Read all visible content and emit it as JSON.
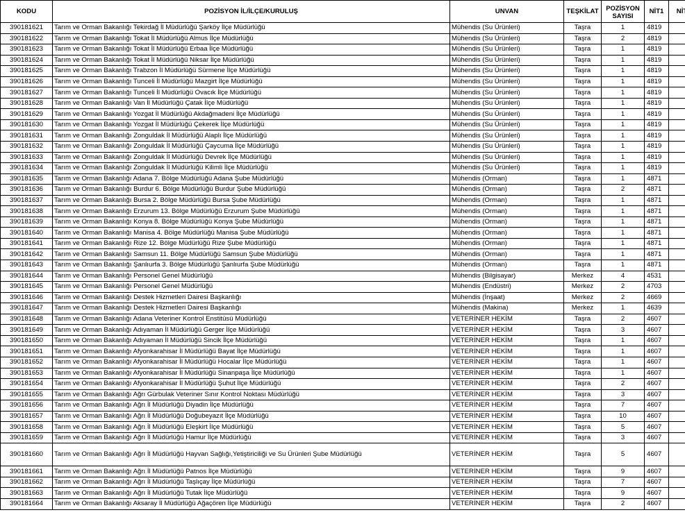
{
  "headers": [
    "KODU",
    "POZİSYON İL/İLÇE/KURULUŞ",
    "UNVAN",
    "TEŞKİLAT",
    "POZİSYON SAYISI",
    "NİT1",
    "NİT"
  ],
  "rows": [
    [
      "390181621",
      "Tarım ve Orman Bakanlığı Tekirdağ İl Müdürlüğü Şarköy İlçe Müdürlüğü",
      "Mühendis (Su Ürünleri)",
      "Taşra",
      "1",
      "4819",
      ""
    ],
    [
      "390181622",
      "Tarım ve Orman Bakanlığı Tokat İl Müdürlüğü Almus İlçe Müdürlüğü",
      "Mühendis (Su Ürünleri)",
      "Taşra",
      "2",
      "4819",
      ""
    ],
    [
      "390181623",
      "Tarım ve Orman Bakanlığı Tokat İl Müdürlüğü Erbaa İlçe Müdürlüğü",
      "Mühendis (Su Ürünleri)",
      "Taşra",
      "1",
      "4819",
      ""
    ],
    [
      "390181624",
      "Tarım ve Orman Bakanlığı Tokat İl Müdürlüğü Niksar İlçe Müdürlüğü",
      "Mühendis (Su Ürünleri)",
      "Taşra",
      "1",
      "4819",
      ""
    ],
    [
      "390181625",
      "Tarım ve Orman Bakanlığı Trabzon İl Müdürlüğü Sürmene İlçe Müdürlüğü",
      "Mühendis (Su Ürünleri)",
      "Taşra",
      "1",
      "4819",
      ""
    ],
    [
      "390181626",
      "Tarım ve Orman Bakanlığı Tunceli İl Müdürlüğü Mazgirt İlçe Müdürlüğü",
      "Mühendis (Su Ürünleri)",
      "Taşra",
      "1",
      "4819",
      ""
    ],
    [
      "390181627",
      "Tarım ve Orman Bakanlığı Tunceli İl Müdürlüğü Ovacık İlçe Müdürlüğü",
      "Mühendis (Su Ürünleri)",
      "Taşra",
      "1",
      "4819",
      ""
    ],
    [
      "390181628",
      "Tarım ve Orman Bakanlığı Van İl Müdürlüğü Çatak İlçe Müdürlüğü",
      "Mühendis (Su Ürünleri)",
      "Taşra",
      "1",
      "4819",
      ""
    ],
    [
      "390181629",
      "Tarım ve Orman Bakanlığı Yozgat İl Müdürlüğü Akdağmadeni İlçe Müdürlüğü",
      "Mühendis (Su Ürünleri)",
      "Taşra",
      "1",
      "4819",
      ""
    ],
    [
      "390181630",
      "Tarım ve Orman Bakanlığı Yozgat İl Müdürlüğü Çekerek İlçe Müdürlüğü",
      "Mühendis (Su Ürünleri)",
      "Taşra",
      "1",
      "4819",
      ""
    ],
    [
      "390181631",
      "Tarım ve Orman Bakanlığı Zonguldak İl Müdürlüğü Alaplı İlçe Müdürlüğü",
      "Mühendis (Su Ürünleri)",
      "Taşra",
      "1",
      "4819",
      ""
    ],
    [
      "390181632",
      "Tarım ve Orman Bakanlığı Zonguldak İl Müdürlüğü Çaycuma İlçe Müdürlüğü",
      "Mühendis (Su Ürünleri)",
      "Taşra",
      "1",
      "4819",
      ""
    ],
    [
      "390181633",
      "Tarım ve Orman Bakanlığı Zonguldak İl Müdürlüğü Devrek İlçe Müdürlüğü",
      "Mühendis (Su Ürünleri)",
      "Taşra",
      "1",
      "4819",
      ""
    ],
    [
      "390181634",
      "Tarım ve Orman Bakanlığı Zonguldak İl Müdürlüğü Kilimli İlçe Müdürlüğü",
      "Mühendis (Su Ürünleri)",
      "Taşra",
      "1",
      "4819",
      ""
    ],
    [
      "390181635",
      "Tarım ve Orman Bakanlığı Adana 7. Bölge Müdürlüğü Adana Şube Müdürlüğü",
      "Mühendis (Orman)",
      "Taşra",
      "1",
      "4871",
      ""
    ],
    [
      "390181636",
      "Tarım ve Orman Bakanlığı Burdur 6. Bölge Müdürlüğü Burdur Şube Müdürlüğü",
      "Mühendis (Orman)",
      "Taşra",
      "2",
      "4871",
      ""
    ],
    [
      "390181637",
      "Tarım ve Orman Bakanlığı Bursa 2. Bölge Müdürlüğü Bursa Şube Müdürlüğü",
      "Mühendis (Orman)",
      "Taşra",
      "1",
      "4871",
      ""
    ],
    [
      "390181638",
      "Tarım ve Orman Bakanlığı Erzurum 13. Bölge Müdürlüğü Erzurum Şube Müdürlüğü",
      "Mühendis (Orman)",
      "Taşra",
      "1",
      "4871",
      ""
    ],
    [
      "390181639",
      "Tarım ve Orman Bakanlığı Konya 8. Bölge Müdürlüğü Konya Şube Müdürlüğü",
      "Mühendis (Orman)",
      "Taşra",
      "1",
      "4871",
      ""
    ],
    [
      "390181640",
      "Tarım ve Orman Bakanlığı Manisa 4. Bölge Müdürlüğü Manisa Şube Müdürlüğü",
      "Mühendis (Orman)",
      "Taşra",
      "1",
      "4871",
      ""
    ],
    [
      "390181641",
      "Tarım ve Orman Bakanlığı Rize 12. Bölge Müdürlüğü Rize Şube Müdürlüğü",
      "Mühendis (Orman)",
      "Taşra",
      "1",
      "4871",
      ""
    ],
    [
      "390181642",
      "Tarım ve Orman Bakanlığı Samsun 11. Bölge Müdürlüğü Samsun Şube Müdürlüğü",
      "Mühendis (Orman)",
      "Taşra",
      "1",
      "4871",
      ""
    ],
    [
      "390181643",
      "Tarım ve Orman Bakanlığı Şanlıurfa 3. Bölge Müdürlüğü Şanlıurfa Şube Müdürlüğü",
      "Mühendis (Orman)",
      "Taşra",
      "1",
      "4871",
      ""
    ],
    [
      "390181644",
      "Tarım ve Orman Bakanlığı Personel Genel Müdürlüğü",
      "Mühendis (Bilgisayar)",
      "Merkez",
      "4",
      "4531",
      ""
    ],
    [
      "390181645",
      "Tarım ve Orman Bakanlığı Personel Genel Müdürlüğü",
      "Mühendis (Endüstri)",
      "Merkez",
      "2",
      "4703",
      ""
    ],
    [
      "390181646",
      "Tarım ve Orman Bakanlığı Destek Hizmetleri Dairesi Başkanlığı",
      "Mühendis (İnşaat)",
      "Merkez",
      "2",
      "4669",
      ""
    ],
    [
      "390181647",
      "Tarım ve Orman Bakanlığı Destek Hizmetleri Dairesi Başkanlığı",
      "Mühendis (Makina)",
      "Merkez",
      "1",
      "4639",
      ""
    ],
    [
      "390181648",
      "Tarım ve Orman Bakanlığı Adana Veteriner Kontrol Enstitüsü Müdürlüğü",
      "VETERİNER HEKİM",
      "Taşra",
      "2",
      "4607",
      ""
    ],
    [
      "390181649",
      "Tarım ve Orman Bakanlığı Adıyaman İl Müdürlüğü Gerger İlçe Müdürlüğü",
      "VETERİNER HEKİM",
      "Taşra",
      "3",
      "4607",
      ""
    ],
    [
      "390181650",
      "Tarım ve Orman Bakanlığı Adıyaman İl Müdürlüğü Sincik İlçe Müdürlüğü",
      "VETERİNER HEKİM",
      "Taşra",
      "1",
      "4607",
      ""
    ],
    [
      "390181651",
      "Tarım ve Orman Bakanlığı Afyonkarahisar İl Müdürlüğü Bayat İlçe Müdürlüğü",
      "VETERİNER HEKİM",
      "Taşra",
      "1",
      "4607",
      ""
    ],
    [
      "390181652",
      "Tarım ve Orman Bakanlığı Afyonkarahisar İl Müdürlüğü Hocalar İlçe Müdürlüğü",
      "VETERİNER HEKİM",
      "Taşra",
      "1",
      "4607",
      ""
    ],
    [
      "390181653",
      "Tarım ve Orman Bakanlığı Afyonkarahisar İl Müdürlüğü Sinanpaşa İlçe Müdürlüğü",
      "VETERİNER HEKİM",
      "Taşra",
      "1",
      "4607",
      ""
    ],
    [
      "390181654",
      "Tarım ve Orman Bakanlığı Afyonkarahisar İl Müdürlüğü Şuhut İlçe Müdürlüğü",
      "VETERİNER HEKİM",
      "Taşra",
      "2",
      "4607",
      ""
    ],
    [
      "390181655",
      "Tarım ve Orman Bakanlığı Ağrı Gürbulak Veteriner Sınır Kontrol Noktası Müdürlüğü",
      "VETERİNER HEKİM",
      "Taşra",
      "3",
      "4607",
      ""
    ],
    [
      "390181656",
      "Tarım ve Orman Bakanlığı Ağrı İl Müdürlüğü Diyadin İlçe Müdürlüğü",
      "VETERİNER HEKİM",
      "Taşra",
      "7",
      "4607",
      ""
    ],
    [
      "390181657",
      "Tarım ve Orman Bakanlığı Ağrı İl Müdürlüğü Doğubeyazıt İlçe Müdürlüğü",
      "VETERİNER HEKİM",
      "Taşra",
      "10",
      "4607",
      ""
    ],
    [
      "390181658",
      "Tarım ve Orman Bakanlığı Ağrı İl Müdürlüğü Eleşkirt İlçe Müdürlüğü",
      "VETERİNER HEKİM",
      "Taşra",
      "5",
      "4607",
      ""
    ],
    [
      "390181659",
      "Tarım ve Orman Bakanlığı Ağrı İl Müdürlüğü Hamur İlçe Müdürlüğü",
      "VETERİNER HEKİM",
      "Taşra",
      "3",
      "4607",
      ""
    ],
    [
      "390181660",
      "Tarım ve Orman Bakanlığı Ağrı İl Müdürlüğü Hayvan Sağlığı,Yetiştiriciliği ve Su Ürünleri Şube Müdürlüğü",
      "VETERİNER HEKİM",
      "Taşra",
      "5",
      "4607",
      ""
    ],
    [
      "390181661",
      "Tarım ve Orman Bakanlığı Ağrı İl Müdürlüğü Patnos İlçe Müdürlüğü",
      "VETERİNER HEKİM",
      "Taşra",
      "9",
      "4607",
      ""
    ],
    [
      "390181662",
      "Tarım ve Orman Bakanlığı Ağrı İl Müdürlüğü Taşlıçay İlçe Müdürlüğü",
      "VETERİNER HEKİM",
      "Taşra",
      "7",
      "4607",
      ""
    ],
    [
      "390181663",
      "Tarım ve Orman Bakanlığı Ağrı İl Müdürlüğü Tutak İlçe Müdürlüğü",
      "VETERİNER HEKİM",
      "Taşra",
      "9",
      "4607",
      ""
    ],
    [
      "390181664",
      "Tarım ve Orman Bakanlığı Aksaray İl Müdürlüğü Ağaçören İlçe Müdürlüğü",
      "VETERİNER HEKİM",
      "Taşra",
      "2",
      "4607",
      ""
    ]
  ]
}
